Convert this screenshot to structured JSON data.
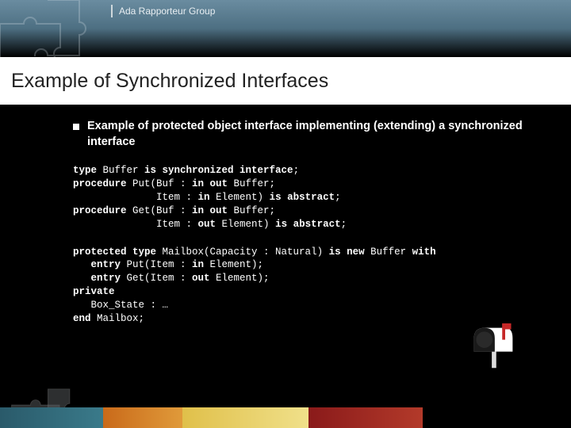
{
  "header": {
    "group": "Ada Rapporteur Group"
  },
  "title": "Example of Synchronized Interfaces",
  "bullet": "Example of protected object interface implementing (extending) a synchronized interface",
  "code1": {
    "l1a": "type",
    "l1b": " Buffer ",
    "l1c": "is synchronized interface",
    "l1d": ";",
    "l2a": "procedure",
    "l2b": " Put(Buf : ",
    "l2c": "in out",
    "l2d": " Buffer;",
    "l3a": "              Item : ",
    "l3b": "in",
    "l3c": " Element) ",
    "l3d": "is abstract",
    "l3e": ";",
    "l4a": "procedure",
    "l4b": " Get(Buf : ",
    "l4c": "in out",
    "l4d": " Buffer;",
    "l5a": "              Item : ",
    "l5b": "out",
    "l5c": " Element) ",
    "l5d": "is abstract",
    "l5e": ";"
  },
  "code2": {
    "l1a": "protected type",
    "l1b": " Mailbox(Capacity : Natural) ",
    "l1c": "is new",
    "l1d": " Buffer ",
    "l1e": "with",
    "l2a": "   entry",
    "l2b": " Put(Item : ",
    "l2c": "in",
    "l2d": " Element);",
    "l3a": "   entry",
    "l3b": " Get(Item : ",
    "l3c": "out",
    "l3d": " Element);",
    "l4a": "private",
    "l5a": "   Box_State : …",
    "l6a": "end",
    "l6b": " Mailbox;"
  }
}
